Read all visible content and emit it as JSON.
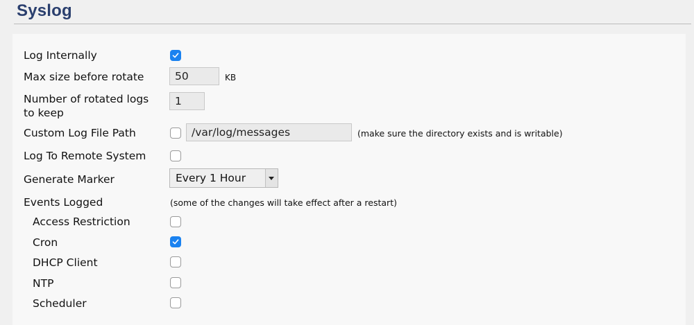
{
  "page": {
    "title": "Syslog"
  },
  "form": {
    "log_internally": {
      "label": "Log Internally",
      "checked": true
    },
    "max_size": {
      "label": "Max size before rotate",
      "value": "50",
      "unit": "KB"
    },
    "rotated_logs": {
      "label": "Number of rotated logs to keep",
      "value": "1"
    },
    "custom_path": {
      "label": "Custom Log File Path",
      "checked": false,
      "value": "/var/log/messages",
      "hint": "(make sure the directory exists and is writable)"
    },
    "remote": {
      "label": "Log To Remote System",
      "checked": false
    },
    "marker": {
      "label": "Generate Marker",
      "value": "Every 1 Hour"
    },
    "events": {
      "label": "Events Logged",
      "hint": "(some of the changes will take effect after a restart)",
      "items": [
        {
          "label": "Access Restriction",
          "checked": false
        },
        {
          "label": "Cron",
          "checked": true
        },
        {
          "label": "DHCP Client",
          "checked": false
        },
        {
          "label": "NTP",
          "checked": false
        },
        {
          "label": "Scheduler",
          "checked": false
        }
      ]
    }
  },
  "colors": {
    "title": "#2a3f6e",
    "checkbox_checked": "#1a82f0",
    "panel_background": "#f8f8f8",
    "page_background": "#f0f0f0"
  },
  "icons": {
    "checkmark": "check-icon",
    "dropdown": "chevron-down-icon"
  }
}
